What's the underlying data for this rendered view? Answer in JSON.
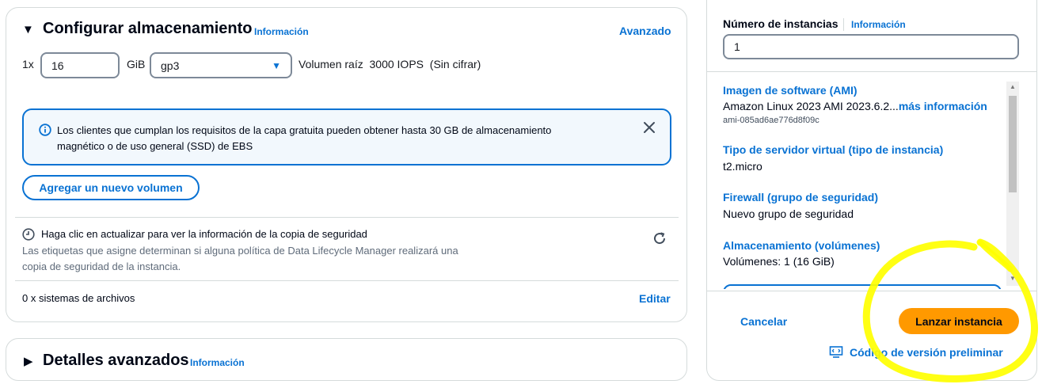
{
  "storage": {
    "title": "Configurar almacenamiento",
    "info_label": "Información",
    "advanced_link": "Avanzado",
    "volume": {
      "count_prefix": "1x",
      "size_value": "16",
      "unit": "GiB",
      "type_value": "gp3",
      "root_label": "Volumen raíz",
      "iops": "3000 IOPS",
      "encryption": "(Sin cifrar)"
    },
    "alert": {
      "line1": "Los clientes que cumplan los requisitos de la capa gratuita pueden obtener hasta 30 GB de almacenamiento",
      "line2": "magnético o de uso general (SSD) de EBS"
    },
    "add_volume_label": "Agregar un nuevo volumen",
    "backup": {
      "headline": "Haga clic en actualizar para ver la información de la copia de seguridad",
      "desc_line1": "Las etiquetas que asigne determinan si alguna política de Data Lifecycle Manager realizará una",
      "desc_line2": "copia de seguridad de la instancia."
    },
    "filesystems_label": "0 x sistemas de archivos",
    "edit_label": "Editar"
  },
  "advanced": {
    "title": "Detalles avanzados",
    "info_label": "Información"
  },
  "summary": {
    "instances_label": "Número de instancias",
    "instances_info": "Información",
    "instances_value": "1",
    "items": [
      {
        "label": "Imagen de software (AMI)",
        "value": "Amazon Linux 2023 AMI 2023.6.2...",
        "more": "más información",
        "sub": "ami-085ad6ae776d8f09c"
      },
      {
        "label": "Tipo de servidor virtual (tipo de instancia)",
        "value": "t2.micro"
      },
      {
        "label": "Firewall (grupo de seguridad)",
        "value": "Nuevo grupo de seguridad"
      },
      {
        "label": "Almacenamiento (volúmenes)",
        "value": "Volúmenes: 1 (16 GiB)"
      }
    ],
    "cancel_label": "Cancelar",
    "launch_label": "Lanzar instancia",
    "preview_label": "Código de versión preliminar"
  },
  "colors": {
    "link": "#0972d3",
    "launch": "#ff9900",
    "highlight": "#ffff00"
  }
}
